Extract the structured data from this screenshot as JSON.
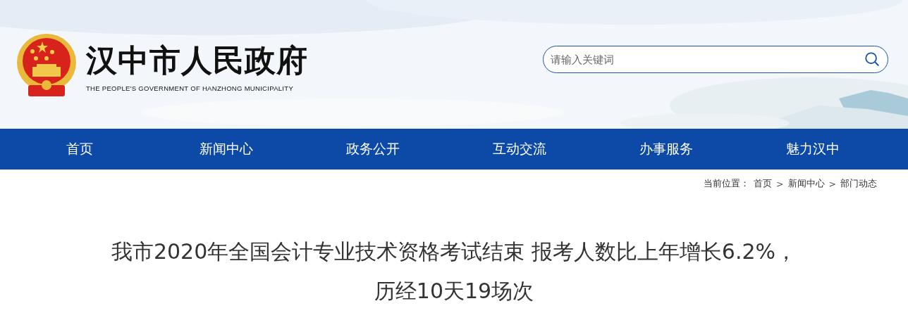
{
  "header": {
    "site_title": "汉中市人民政府",
    "site_subtitle": "THE PEOPLE'S GOVERNMENT OF HANZHONG MUNICIPALITY",
    "search": {
      "placeholder": "请输入关键词"
    }
  },
  "nav": [
    {
      "label": "首页"
    },
    {
      "label": "新闻中心"
    },
    {
      "label": "政务公开"
    },
    {
      "label": "互动交流"
    },
    {
      "label": "办事服务"
    },
    {
      "label": "魅力汉中"
    }
  ],
  "breadcrumb": {
    "label": "当前位置：",
    "items": [
      {
        "text": "首页",
        "separator": ">"
      },
      {
        "text": "新闻中心",
        "separator": ">"
      },
      {
        "text": "部门动态"
      }
    ]
  },
  "article": {
    "title": "我市2020年全国会计专业技术资格考试结束 报考人数比上年增长6.2%，历经10天19场次"
  }
}
